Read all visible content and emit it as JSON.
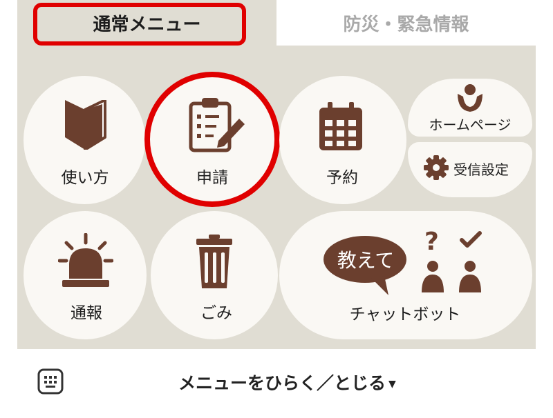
{
  "tabs": {
    "active": "通常メニュー",
    "inactive": "防災・緊急情報"
  },
  "menu": {
    "guide": "使い方",
    "apply": "申請",
    "reserve": "予約",
    "homepage": "ホームページ",
    "receive_settings": "受信設定",
    "report": "通報",
    "garbage": "ごみ",
    "chatbot": "チャットボット",
    "chatbot_bubble": "教えて"
  },
  "footer": {
    "toggle_label": "メニューをひらく／とじる"
  },
  "colors": {
    "brown": "#6b3f2e",
    "panel": "#e0ddd3",
    "button": "#faf8f4",
    "highlight": "#e00000"
  }
}
